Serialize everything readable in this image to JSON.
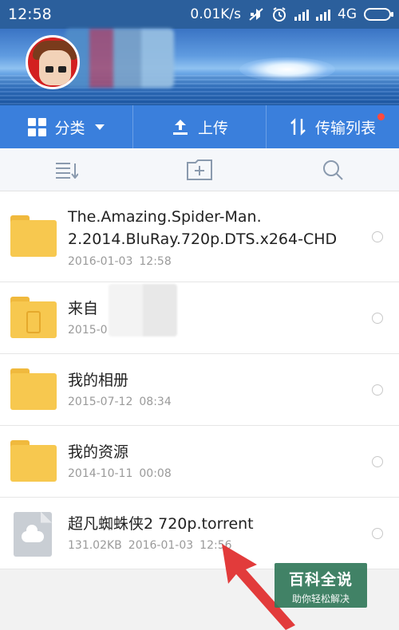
{
  "status_bar": {
    "time": "12:58",
    "speed": "0.01K/s",
    "network": "4G"
  },
  "toolbar": {
    "category_label": "分类",
    "upload_label": "上传",
    "transfer_label": "传输列表"
  },
  "files": [
    {
      "name": "The.Amazing.Spider-Man.\n2.2014.BluRay.720p.DTS.x264-CHD",
      "date": "2016-01-03",
      "time": "12:58",
      "type": "folder"
    },
    {
      "name": "来自",
      "date": "2015-0",
      "time": "",
      "type": "folder-phone"
    },
    {
      "name": "我的相册",
      "date": "2015-07-12",
      "time": "08:34",
      "type": "folder"
    },
    {
      "name": "我的资源",
      "date": "2014-10-11",
      "time": "00:08",
      "type": "folder"
    },
    {
      "name": "超凡蜘蛛侠2 720p.torrent",
      "size": "131.02KB",
      "date": "2016-01-03",
      "time": "12:56",
      "type": "file"
    }
  ],
  "watermark": {
    "title": "百科全说",
    "subtitle": "助你轻松解决"
  },
  "colors": {
    "accent": "#3a7fdc",
    "status_bar": "#2b5f9c",
    "folder": "#f7c84f",
    "badge": "#ff4a3d"
  },
  "icons": {
    "grid": "grid-icon",
    "upload": "upload-icon",
    "transfer": "transfer-icon",
    "sort": "sort-icon",
    "new_folder": "new-folder-icon",
    "search": "search-icon"
  }
}
